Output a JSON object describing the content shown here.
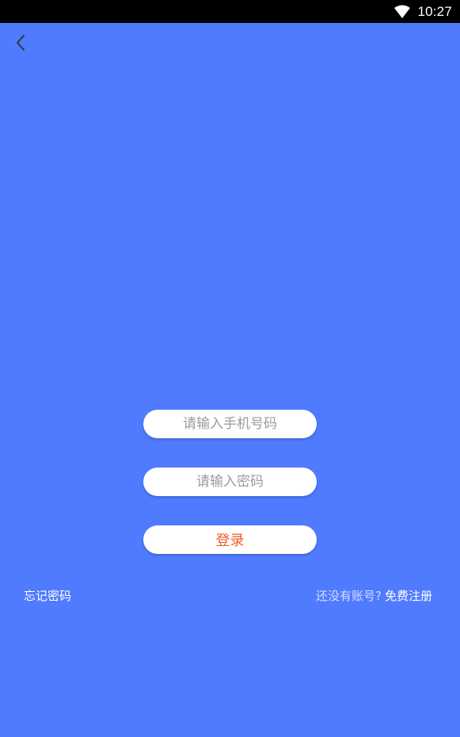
{
  "status_bar": {
    "time": "10:27",
    "wifi_icon": "wifi-icon"
  },
  "nav": {
    "back_icon": "chevron-left-icon"
  },
  "form": {
    "phone_placeholder": "请输入手机号码",
    "password_placeholder": "请输入密码",
    "login_label": "登录"
  },
  "links": {
    "forgot_password": "忘记密码",
    "no_account": "还没有账号?",
    "register": "免费注册"
  },
  "colors": {
    "background": "#507bff",
    "login_text": "#f15a2b"
  }
}
